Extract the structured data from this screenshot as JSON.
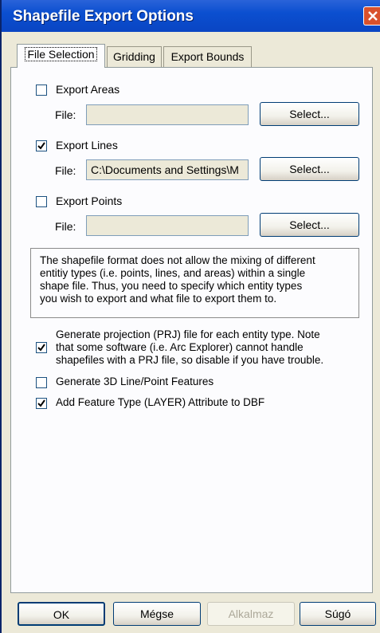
{
  "window": {
    "title": "Shapefile Export Options"
  },
  "tabs": [
    {
      "label": "File Selection",
      "active": true
    },
    {
      "label": "Gridding",
      "active": false
    },
    {
      "label": "Export Bounds",
      "active": false
    }
  ],
  "export_areas": {
    "label": "Export Areas",
    "checked": false,
    "file_label": "File:",
    "file_value": "",
    "select_label": "Select..."
  },
  "export_lines": {
    "label": "Export Lines",
    "checked": true,
    "file_label": "File:",
    "file_value": "C:\\Documents and Settings\\M",
    "select_label": "Select..."
  },
  "export_points": {
    "label": "Export Points",
    "checked": false,
    "file_label": "File:",
    "file_value": "",
    "select_label": "Select..."
  },
  "note": {
    "line1": "The shapefile format does not allow the mixing of different",
    "line2": "entitiy types (i.e. points, lines, and areas) within a single",
    "line3": "shape file. Thus, you need to specify which entity types",
    "line4": "you wish to export and what file to export them to."
  },
  "options": {
    "prj": {
      "checked": true,
      "line1": "Generate projection (PRJ) file for each entity type. Note",
      "line2": "that some software (i.e. Arc Explorer) cannot handle",
      "line3": "shapefiles with a PRJ file, so disable if you have trouble."
    },
    "three_d": {
      "checked": false,
      "label": "Generate 3D Line/Point Features"
    },
    "layer_attr": {
      "checked": true,
      "label": "Add Feature Type (LAYER) Attribute to DBF"
    }
  },
  "buttons": {
    "ok": "OK",
    "cancel": "Mégse",
    "apply": "Alkalmaz",
    "help": "Súgó"
  },
  "colors": {
    "title_bar": "#0b4fd0",
    "close_button": "#d9512c",
    "dialog_bg": "#ece9d8"
  }
}
